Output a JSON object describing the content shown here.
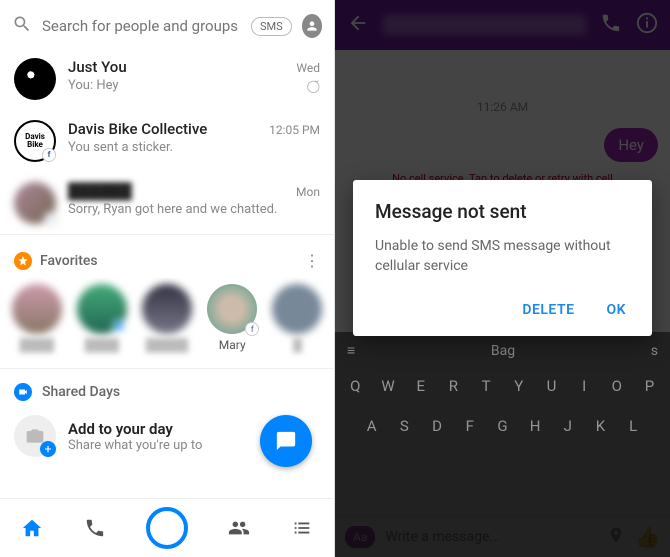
{
  "left": {
    "search_placeholder": "Search for people and groups",
    "sms_badge": "SMS",
    "conversations": [
      {
        "name": "Just You",
        "preview": "You: Hey",
        "time": "Wed",
        "status_icon": "delivered"
      },
      {
        "name": "Davis Bike Collective",
        "preview": "You sent a sticker.",
        "time": "12:05 PM"
      },
      {
        "name": "██████",
        "preview": "Sorry, Ryan got here and we chatted.",
        "time": "Mon",
        "blurred": true
      }
    ],
    "favorites_label": "Favorites",
    "favorites": [
      {
        "name": "████",
        "blurred": true,
        "online": false
      },
      {
        "name": "████",
        "blurred": true,
        "online": true
      },
      {
        "name": "█████",
        "blurred": true,
        "online": false
      },
      {
        "name": "Mary",
        "blurred": false,
        "online": false,
        "fb": true
      },
      {
        "name": "█",
        "blurred": true,
        "online": false
      }
    ],
    "shared_days_label": "Shared Days",
    "add_day_title": "Add to your day",
    "add_day_sub": "Share what you're up to"
  },
  "right": {
    "header_title": "██████████",
    "timestamp": "11:26 AM",
    "message_out": "Hey",
    "error_line": "No cell service. Tap to delete or retry with cell",
    "pill": "Aa",
    "input_placeholder": "Write a message...",
    "dialog": {
      "title": "Message not sent",
      "body": "Unable to send SMS message without cellular service",
      "delete": "DELETE",
      "ok": "OK"
    },
    "suggestion_center": "Bag",
    "suggestion_right": "s",
    "krow1": [
      "Q",
      "W",
      "E",
      "R",
      "T",
      "Y",
      "U",
      "I",
      "O",
      "P"
    ],
    "krow2": [
      "A",
      "S",
      "D",
      "F",
      "G",
      "H",
      "J",
      "K",
      "L"
    ]
  }
}
